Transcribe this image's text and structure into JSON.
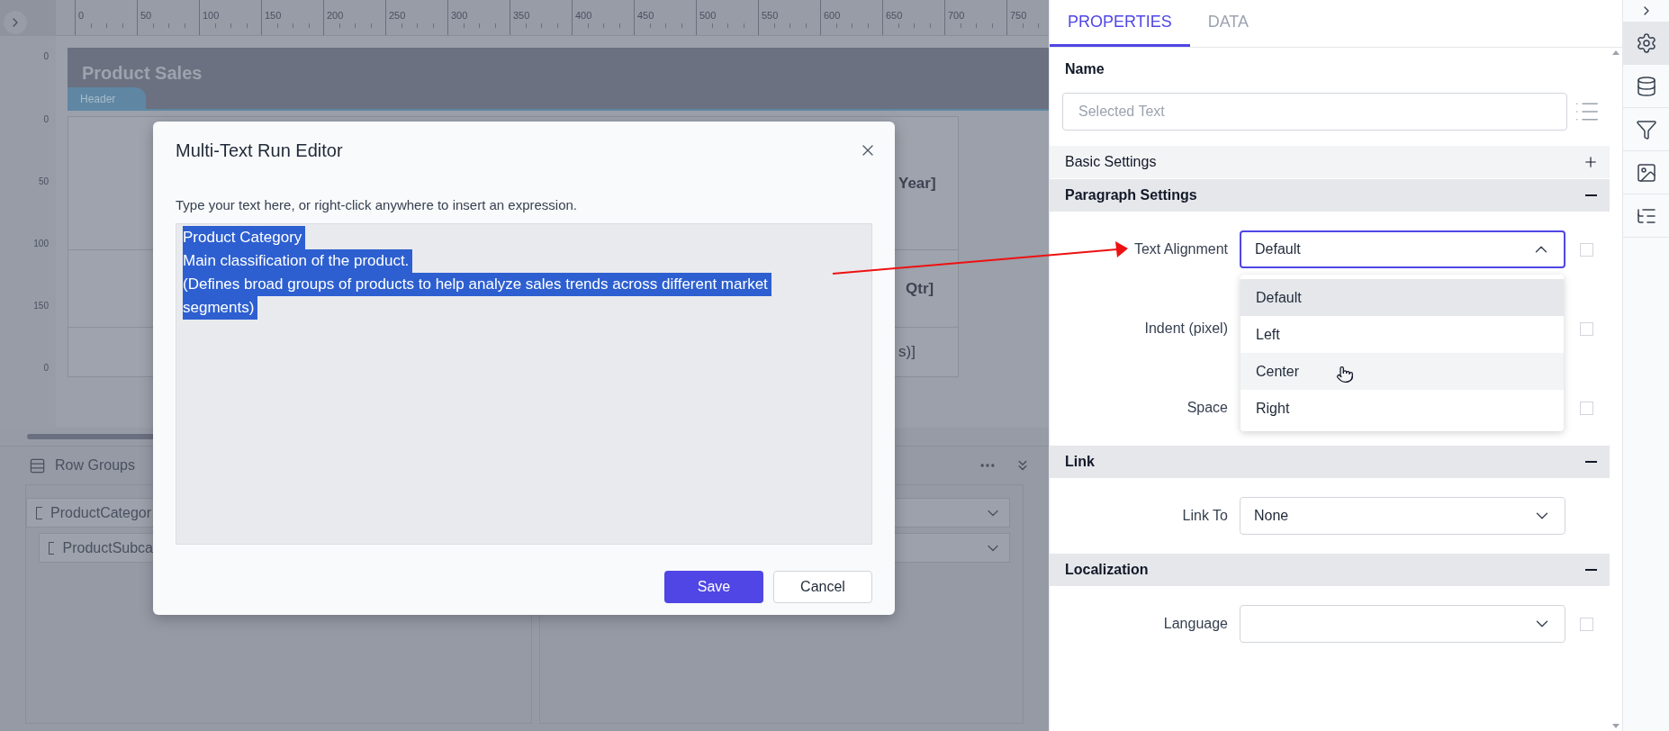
{
  "designer": {
    "ruler_marks": [
      "0",
      "50",
      "100",
      "150",
      "200",
      "250",
      "300",
      "350",
      "400",
      "450",
      "500",
      "550",
      "600",
      "650",
      "700",
      "750"
    ],
    "vertical_ruler_marks": [
      "0",
      "0",
      "50",
      "100",
      "150",
      "0"
    ],
    "header_band": {
      "title": "Product Sales",
      "tab": "Header"
    },
    "cell_texts": [
      "Year]",
      "Qtr]",
      "s)]"
    ]
  },
  "row_groups": {
    "title": "Row Groups",
    "items": [
      {
        "label": "ProductCategor",
        "children": [
          {
            "label": "ProductSubca"
          }
        ]
      }
    ]
  },
  "dialog": {
    "title": "Multi-Text Run Editor",
    "hint": "Type your text here, or right-click anywhere to insert an expression.",
    "lines": [
      "Product Category",
      "Main classification of the product.",
      "(Defines broad groups of products to help analyze sales trends across different market",
      "segments)"
    ],
    "buttons": [
      {
        "label": "Save",
        "kind": "primary"
      },
      {
        "label": "Cancel",
        "kind": "secondary"
      }
    ]
  },
  "properties": {
    "tabs": [
      {
        "label": "PROPERTIES",
        "selected": true
      },
      {
        "label": "DATA",
        "selected": false
      }
    ],
    "name_label": "Name",
    "name_placeholder": "Selected Text",
    "sections": [
      {
        "title": "Basic Settings",
        "expanded": false
      },
      {
        "title": "Paragraph Settings",
        "expanded": true,
        "fields": [
          {
            "label": "Text Alignment",
            "kind": "select",
            "value": "Default",
            "open": true,
            "checked": false,
            "options": [
              {
                "label": "Default",
                "selected": true,
                "hovered": false
              },
              {
                "label": "Left",
                "selected": false,
                "hovered": false
              },
              {
                "label": "Center",
                "selected": false,
                "hovered": true
              },
              {
                "label": "Right",
                "selected": false,
                "hovered": false
              }
            ]
          },
          {
            "label": "Indent (pixel)",
            "kind": "number",
            "checked": false
          },
          {
            "label": "Space",
            "kind": "number",
            "checked": false
          }
        ]
      },
      {
        "title": "Link",
        "expanded": true,
        "fields": [
          {
            "label": "Link To",
            "kind": "select",
            "value": "None",
            "open": false
          }
        ]
      },
      {
        "title": "Localization",
        "expanded": true,
        "fields": [
          {
            "label": "Language",
            "kind": "select",
            "open": false,
            "checked": false
          }
        ]
      }
    ]
  },
  "toolbar": [
    {
      "kind": "settings",
      "selected": true
    },
    {
      "kind": "database",
      "selected": false
    },
    {
      "kind": "filter",
      "selected": false
    },
    {
      "kind": "image",
      "selected": false
    },
    {
      "kind": "tree",
      "selected": false
    }
  ]
}
